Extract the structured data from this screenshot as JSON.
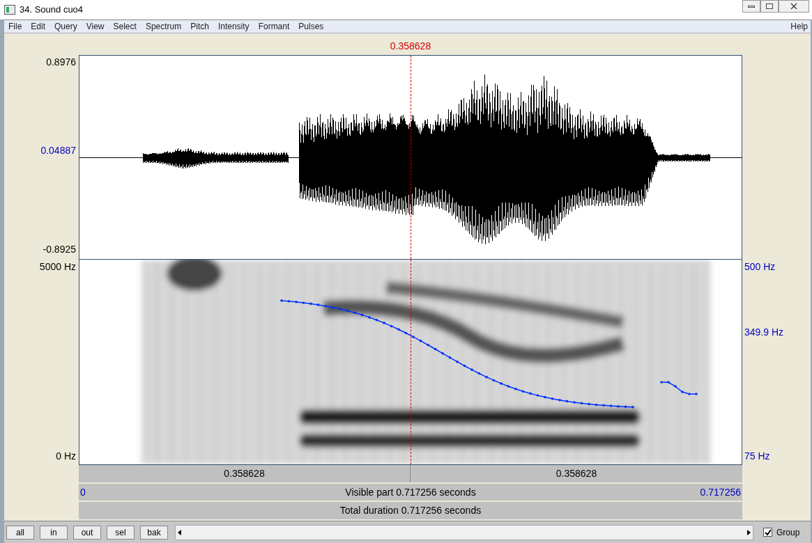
{
  "window": {
    "title": "34. Sound cuo4"
  },
  "menu": [
    "File",
    "Edit",
    "Query",
    "View",
    "Select",
    "Spectrum",
    "Pitch",
    "Intensity",
    "Formant",
    "Pulses"
  ],
  "help_menu": "Help",
  "cursor": {
    "time": "0.358628"
  },
  "waveform": {
    "y_max": "0.8976",
    "y_zero": "0.04887",
    "y_min": "-0.8925"
  },
  "spectrogram": {
    "freq_max": "5000 Hz",
    "freq_min": "0 Hz",
    "pitch_max": "500 Hz",
    "pitch_mid": "349.9 Hz",
    "pitch_min": "75 Hz"
  },
  "time_bars": {
    "left_segment": "0.358628",
    "right_segment": "0.358628",
    "start": "0",
    "visible_part": "Visible part 0.717256 seconds",
    "end": "0.717256",
    "total_duration": "Total duration 0.717256 seconds"
  },
  "buttons": [
    "all",
    "in",
    "out",
    "sel",
    "bak"
  ],
  "group": {
    "label": "Group",
    "checked": true
  }
}
